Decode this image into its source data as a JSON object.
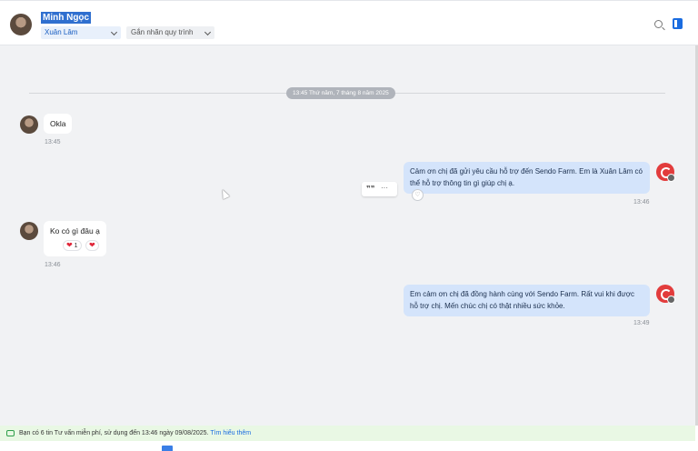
{
  "header": {
    "contact_name": "Minh Ngọc",
    "assignee": "Xuân Lâm",
    "tag_placeholder": "Gắn nhãn quy trình"
  },
  "chat": {
    "date_divider": "13:45 Thứ năm, 7 tháng 8 năm 2025",
    "messages": [
      {
        "text": "Okla",
        "time": "13:45"
      },
      {
        "text": "Cảm ơn chị đã gửi yêu cầu hỗ trợ đến Sendo Farm. Em là Xuân Lâm có thể hỗ trợ thông tin gì giúp chị ạ.",
        "time": "13:46"
      },
      {
        "text": "Ko có gì đâu ạ",
        "time": "13:46",
        "reaction_count": "1"
      },
      {
        "text": "Em cảm ơn chị đã đồng hành cùng với Sendo Farm. Rất vui khi được hỗ trợ chị. Mến chúc chị có thật nhiều sức khỏe.",
        "time": "13:49"
      }
    ]
  },
  "notice": {
    "text": "Bạn có 6 tin Tư vấn miễn phí, sử dụng đến 13:46 ngày 09/08/2025.",
    "link": "Tìm hiểu thêm"
  },
  "icons": {
    "search": "search-icon",
    "panel": "panel-toggle-icon",
    "quote": "quote-icon",
    "more": "more-icon",
    "heart": "heart-icon"
  },
  "colors": {
    "accent": "#1a6ce0",
    "outgoing_bubble": "#d4e4fb",
    "notice_bg": "#e9f8e4",
    "bot_avatar": "#e23c3c"
  }
}
